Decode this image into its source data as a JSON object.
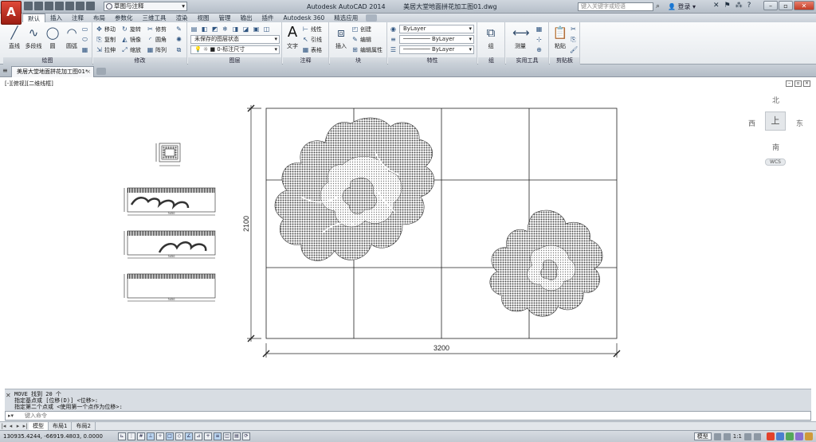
{
  "app": {
    "logo_letter": "A",
    "window_title": "Autodesk AutoCAD 2014",
    "file_name": "美居大堂地面拼花加工图01.dwg",
    "workspace": "草图与注释",
    "search_placeholder": "键入关键字或短语",
    "login_label": "登录"
  },
  "menu_tabs": [
    "默认",
    "插入",
    "注释",
    "布局",
    "参数化",
    "三维工具",
    "渲染",
    "视图",
    "管理",
    "输出",
    "插件",
    "Autodesk 360",
    "精选应用"
  ],
  "ribbon": {
    "draw": {
      "title": "绘图",
      "tools": [
        {
          "label": "直线",
          "icon": "line-icon"
        },
        {
          "label": "多段线",
          "icon": "polyline-icon"
        },
        {
          "label": "圆",
          "icon": "circle-icon"
        },
        {
          "label": "圆弧",
          "icon": "arc-icon"
        }
      ]
    },
    "modify": {
      "title": "修改",
      "rows": [
        [
          "移动",
          "旋转",
          "修剪"
        ],
        [
          "复制",
          "镜像",
          "圆角"
        ],
        [
          "拉伸",
          "缩放",
          "阵列"
        ]
      ]
    },
    "layers": {
      "title": "图层",
      "layer_state": "未保存的图层状态",
      "current_layer": "0-标注尺寸"
    },
    "annotation": {
      "title": "注释",
      "text_label": "文字",
      "items": [
        "线性",
        "引线",
        "表格"
      ]
    },
    "block": {
      "title": "块",
      "insert_label": "插入",
      "items": [
        "创建",
        "编辑",
        "编辑属性"
      ]
    },
    "properties": {
      "title": "特性",
      "color": "ByLayer",
      "linetype": "ByLayer",
      "lineweight": "ByLayer"
    },
    "groups": {
      "title": "组",
      "label": "组"
    },
    "utilities": {
      "title": "实用工具",
      "label": "测量"
    },
    "clipboard": {
      "title": "剪贴板",
      "label": "粘贴"
    }
  },
  "document_tab": "美居大堂地面拼花加工图01*",
  "viewport": {
    "label": "[-][俯视][二维线框]",
    "viewcube": {
      "north": "北",
      "south": "南",
      "east": "东",
      "west": "西",
      "face": "上",
      "wcs": "WCS"
    }
  },
  "drawing": {
    "width_dim": "3200",
    "height_dim": "2100",
    "small_labels": [
      "3450",
      "3450",
      "3450"
    ]
  },
  "command": {
    "history": [
      "MOVE 找到 20 个",
      "指定基点或 [位移(D)] <位移>:",
      "指定第二个点或 <使用第一个点作为位移>:"
    ],
    "input_placeholder": "键入命令"
  },
  "layout_tabs": [
    "模型",
    "布局1",
    "布局2"
  ],
  "status": {
    "coordinates": "130935.4244, -66919.4803, 0.0000",
    "model_label": "模型",
    "scale": "1:1"
  },
  "colors": {
    "logo_red": "#c0281a",
    "flower_gray": "#6e6e6e",
    "grid_line": "#222222"
  }
}
